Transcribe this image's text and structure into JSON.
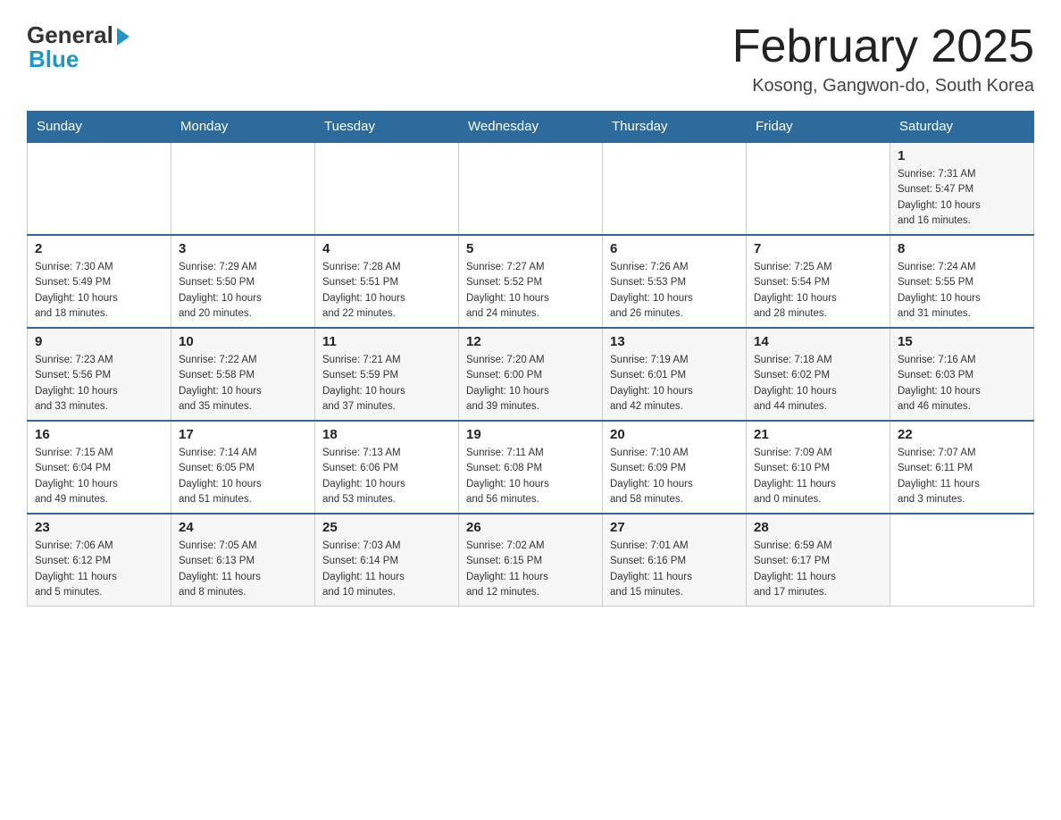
{
  "header": {
    "logo_general": "General",
    "logo_blue": "Blue",
    "month_title": "February 2025",
    "location": "Kosong, Gangwon-do, South Korea"
  },
  "weekdays": [
    "Sunday",
    "Monday",
    "Tuesday",
    "Wednesday",
    "Thursday",
    "Friday",
    "Saturday"
  ],
  "rows": [
    {
      "cells": [
        {
          "day": "",
          "info": ""
        },
        {
          "day": "",
          "info": ""
        },
        {
          "day": "",
          "info": ""
        },
        {
          "day": "",
          "info": ""
        },
        {
          "day": "",
          "info": ""
        },
        {
          "day": "",
          "info": ""
        },
        {
          "day": "1",
          "info": "Sunrise: 7:31 AM\nSunset: 5:47 PM\nDaylight: 10 hours\nand 16 minutes."
        }
      ]
    },
    {
      "cells": [
        {
          "day": "2",
          "info": "Sunrise: 7:30 AM\nSunset: 5:49 PM\nDaylight: 10 hours\nand 18 minutes."
        },
        {
          "day": "3",
          "info": "Sunrise: 7:29 AM\nSunset: 5:50 PM\nDaylight: 10 hours\nand 20 minutes."
        },
        {
          "day": "4",
          "info": "Sunrise: 7:28 AM\nSunset: 5:51 PM\nDaylight: 10 hours\nand 22 minutes."
        },
        {
          "day": "5",
          "info": "Sunrise: 7:27 AM\nSunset: 5:52 PM\nDaylight: 10 hours\nand 24 minutes."
        },
        {
          "day": "6",
          "info": "Sunrise: 7:26 AM\nSunset: 5:53 PM\nDaylight: 10 hours\nand 26 minutes."
        },
        {
          "day": "7",
          "info": "Sunrise: 7:25 AM\nSunset: 5:54 PM\nDaylight: 10 hours\nand 28 minutes."
        },
        {
          "day": "8",
          "info": "Sunrise: 7:24 AM\nSunset: 5:55 PM\nDaylight: 10 hours\nand 31 minutes."
        }
      ]
    },
    {
      "cells": [
        {
          "day": "9",
          "info": "Sunrise: 7:23 AM\nSunset: 5:56 PM\nDaylight: 10 hours\nand 33 minutes."
        },
        {
          "day": "10",
          "info": "Sunrise: 7:22 AM\nSunset: 5:58 PM\nDaylight: 10 hours\nand 35 minutes."
        },
        {
          "day": "11",
          "info": "Sunrise: 7:21 AM\nSunset: 5:59 PM\nDaylight: 10 hours\nand 37 minutes."
        },
        {
          "day": "12",
          "info": "Sunrise: 7:20 AM\nSunset: 6:00 PM\nDaylight: 10 hours\nand 39 minutes."
        },
        {
          "day": "13",
          "info": "Sunrise: 7:19 AM\nSunset: 6:01 PM\nDaylight: 10 hours\nand 42 minutes."
        },
        {
          "day": "14",
          "info": "Sunrise: 7:18 AM\nSunset: 6:02 PM\nDaylight: 10 hours\nand 44 minutes."
        },
        {
          "day": "15",
          "info": "Sunrise: 7:16 AM\nSunset: 6:03 PM\nDaylight: 10 hours\nand 46 minutes."
        }
      ]
    },
    {
      "cells": [
        {
          "day": "16",
          "info": "Sunrise: 7:15 AM\nSunset: 6:04 PM\nDaylight: 10 hours\nand 49 minutes."
        },
        {
          "day": "17",
          "info": "Sunrise: 7:14 AM\nSunset: 6:05 PM\nDaylight: 10 hours\nand 51 minutes."
        },
        {
          "day": "18",
          "info": "Sunrise: 7:13 AM\nSunset: 6:06 PM\nDaylight: 10 hours\nand 53 minutes."
        },
        {
          "day": "19",
          "info": "Sunrise: 7:11 AM\nSunset: 6:08 PM\nDaylight: 10 hours\nand 56 minutes."
        },
        {
          "day": "20",
          "info": "Sunrise: 7:10 AM\nSunset: 6:09 PM\nDaylight: 10 hours\nand 58 minutes."
        },
        {
          "day": "21",
          "info": "Sunrise: 7:09 AM\nSunset: 6:10 PM\nDaylight: 11 hours\nand 0 minutes."
        },
        {
          "day": "22",
          "info": "Sunrise: 7:07 AM\nSunset: 6:11 PM\nDaylight: 11 hours\nand 3 minutes."
        }
      ]
    },
    {
      "cells": [
        {
          "day": "23",
          "info": "Sunrise: 7:06 AM\nSunset: 6:12 PM\nDaylight: 11 hours\nand 5 minutes."
        },
        {
          "day": "24",
          "info": "Sunrise: 7:05 AM\nSunset: 6:13 PM\nDaylight: 11 hours\nand 8 minutes."
        },
        {
          "day": "25",
          "info": "Sunrise: 7:03 AM\nSunset: 6:14 PM\nDaylight: 11 hours\nand 10 minutes."
        },
        {
          "day": "26",
          "info": "Sunrise: 7:02 AM\nSunset: 6:15 PM\nDaylight: 11 hours\nand 12 minutes."
        },
        {
          "day": "27",
          "info": "Sunrise: 7:01 AM\nSunset: 6:16 PM\nDaylight: 11 hours\nand 15 minutes."
        },
        {
          "day": "28",
          "info": "Sunrise: 6:59 AM\nSunset: 6:17 PM\nDaylight: 11 hours\nand 17 minutes."
        },
        {
          "day": "",
          "info": ""
        }
      ]
    }
  ]
}
